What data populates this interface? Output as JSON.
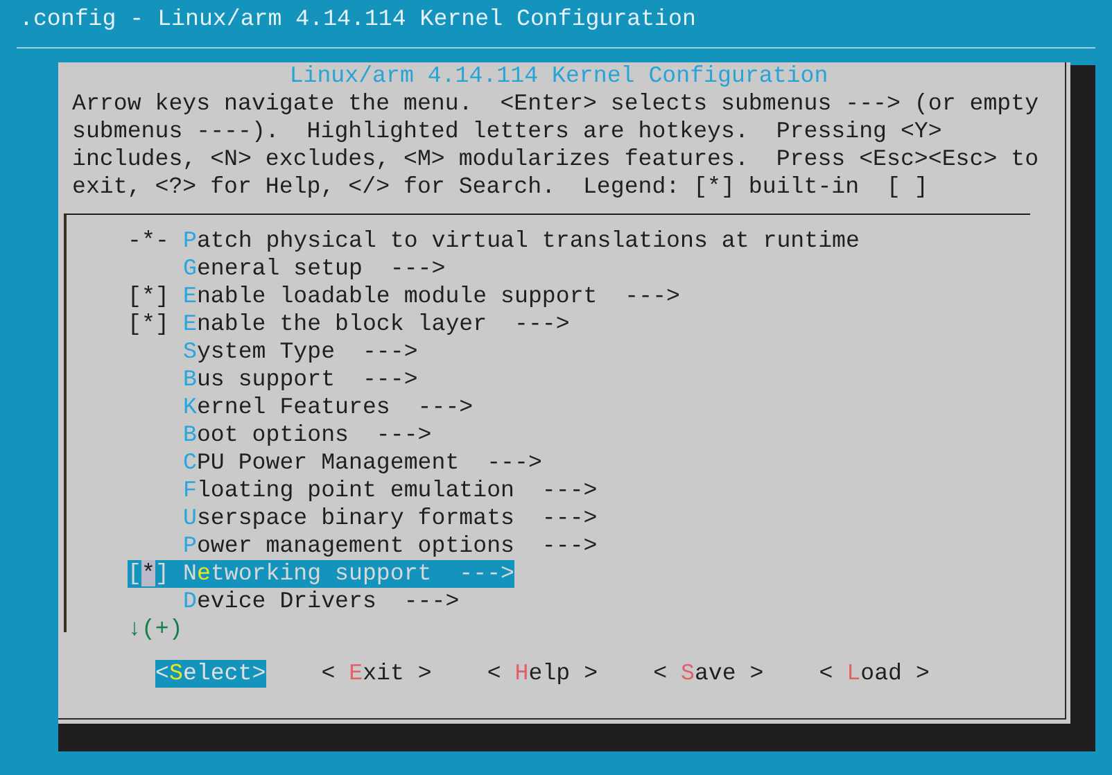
{
  "window": {
    "title": ".config - Linux/arm 4.14.114 Kernel Configuration"
  },
  "dialog": {
    "title": "Linux/arm 4.14.114 Kernel Configuration",
    "help_lines": [
      "Arrow keys navigate the menu.  <Enter> selects submenus ---> (or empty",
      "submenus ----).  Highlighted letters are hotkeys.  Pressing <Y>",
      "includes, <N> excludes, <M> modularizes features.  Press <Esc><Esc> to",
      "exit, <?> for Help, </> for Search.  Legend: [*] built-in  [ ]"
    ],
    "items": [
      {
        "prefix": "-*-",
        "key": "P",
        "rest": "atch physical to virtual translations at runtime",
        "selected": false
      },
      {
        "key": "G",
        "rest": "eneral setup  --->",
        "selected": false
      },
      {
        "prefix": "[*]",
        "key": "E",
        "rest": "nable loadable module support  --->",
        "selected": false
      },
      {
        "prefix": "[*]",
        "key": "E",
        "rest": "nable the block layer  --->",
        "selected": false
      },
      {
        "key": "S",
        "rest": "ystem Type  --->",
        "selected": false
      },
      {
        "key": "B",
        "rest": "us support  --->",
        "selected": false
      },
      {
        "key": "K",
        "rest": "ernel Features  --->",
        "selected": false
      },
      {
        "key": "B",
        "rest": "oot options  --->",
        "selected": false
      },
      {
        "key": "C",
        "rest": "PU Power Management  --->",
        "selected": false
      },
      {
        "key": "F",
        "rest": "loating point emulation  --->",
        "selected": false
      },
      {
        "key": "U",
        "rest": "serspace binary formats  --->",
        "selected": false
      },
      {
        "key": "P",
        "rest": "ower management options  --->",
        "selected": false
      },
      {
        "prefix": "[*]",
        "lead": "N",
        "key": "e",
        "rest": "tworking support  --->",
        "selected": true
      },
      {
        "key": "D",
        "rest": "evice Drivers  --->",
        "selected": false
      }
    ],
    "more_indicator": "↓(+)",
    "buttons": [
      {
        "before": "<",
        "key": "S",
        "after": "elect>",
        "selected": true
      },
      {
        "before": "< ",
        "key": "E",
        "after": "xit >",
        "selected": false
      },
      {
        "before": "< ",
        "key": "H",
        "after": "elp >",
        "selected": false
      },
      {
        "before": "< ",
        "key": "S",
        "after": "ave >",
        "selected": false
      },
      {
        "before": "< ",
        "key": "L",
        "after": "oad >",
        "selected": false
      }
    ]
  }
}
